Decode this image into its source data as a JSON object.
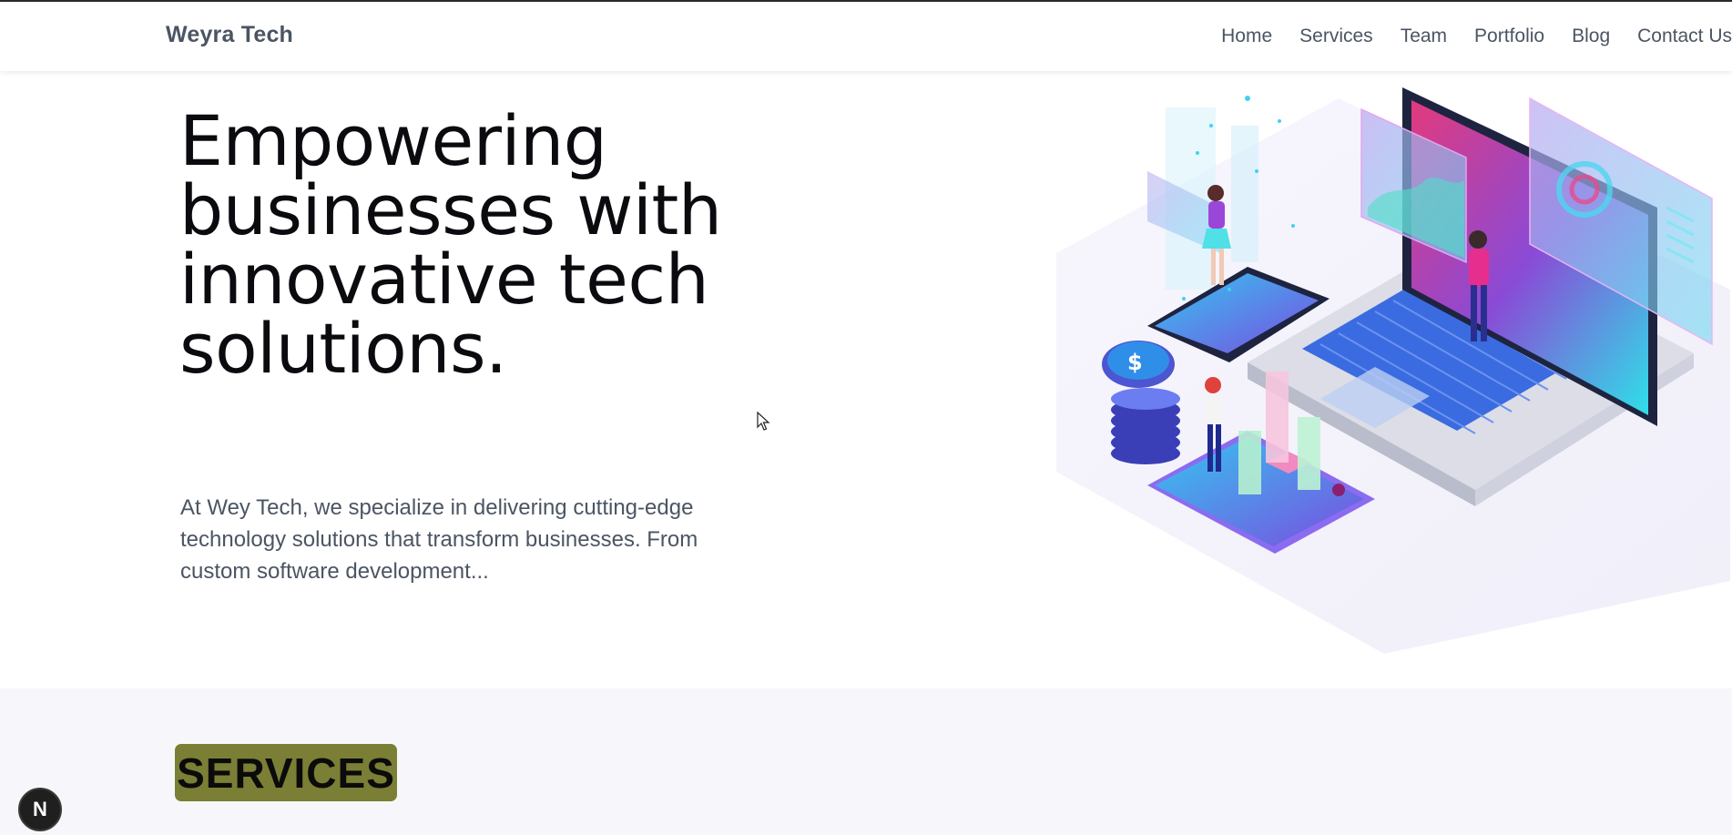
{
  "header": {
    "brand": "Weyra Tech",
    "nav": [
      "Home",
      "Services",
      "Team",
      "Portfolio",
      "Blog",
      "Contact Us"
    ]
  },
  "hero": {
    "headline_lines": [
      "Empowering",
      "businesses with",
      "innovative tech",
      "solutions."
    ],
    "intro": "At Wey Tech, we specialize in delivering cutting-edge technology solutions that transform businesses. From custom software development...",
    "illustration": "isometric-laptop-tech-illustration"
  },
  "services": {
    "badge": "SERVICES"
  },
  "overlay": {
    "dev_badge": "N"
  },
  "colors": {
    "accent_badge": "#7a7f35",
    "nav_text": "#4b5563",
    "services_bg": "#f7f7fb"
  }
}
